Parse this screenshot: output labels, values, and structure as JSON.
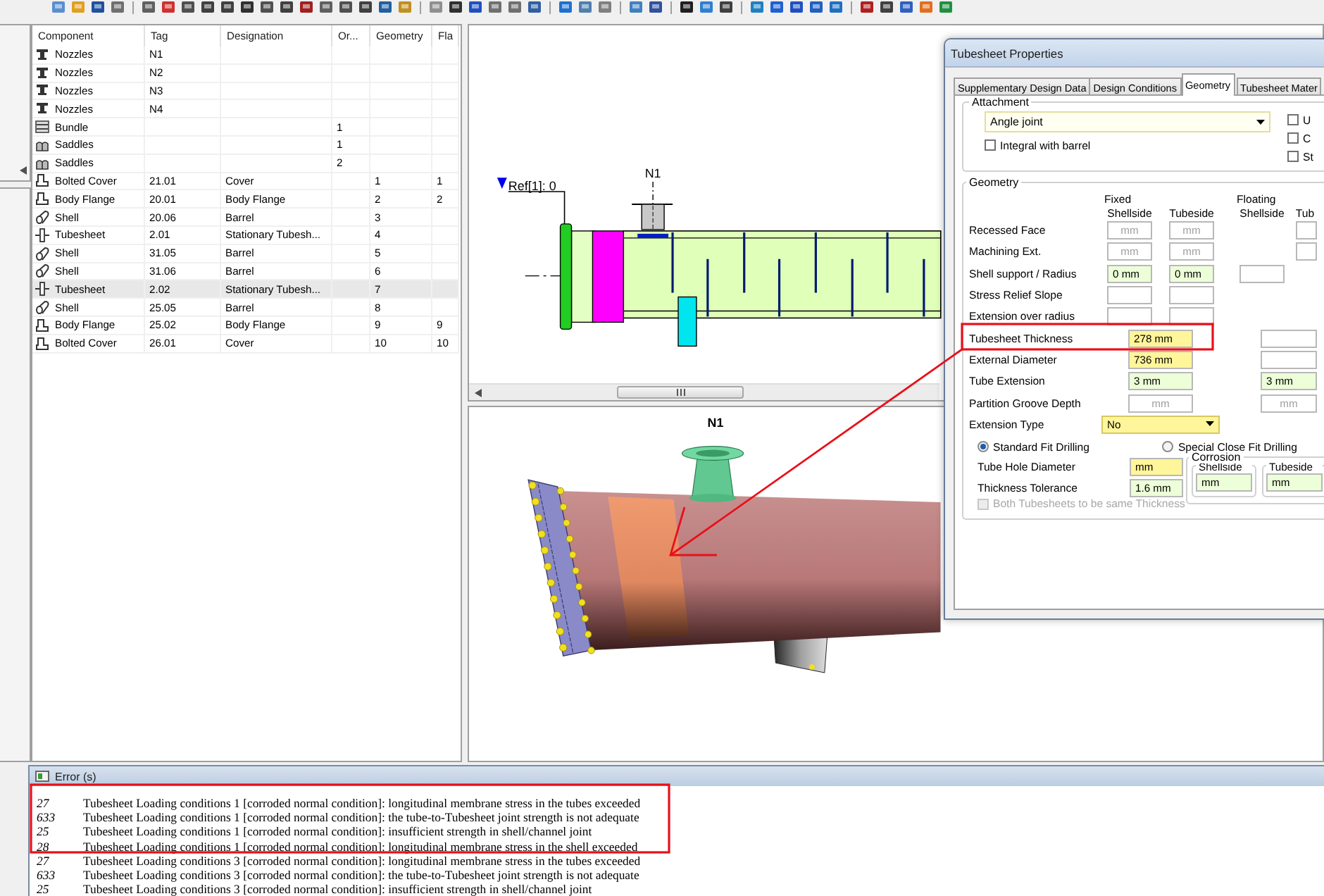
{
  "component_table": {
    "columns": [
      "Component",
      "Tag",
      "Designation",
      "Or...",
      "Geometry",
      "Fla"
    ],
    "rows": [
      {
        "kind": "nozzle",
        "component": "Nozzles",
        "tag": "N1",
        "selected": false
      },
      {
        "kind": "nozzle",
        "component": "Nozzles",
        "tag": "N2",
        "selected": false
      },
      {
        "kind": "nozzle",
        "component": "Nozzles",
        "tag": "N3",
        "selected": false
      },
      {
        "kind": "nozzle",
        "component": "Nozzles",
        "tag": "N4",
        "selected": false
      },
      {
        "kind": "bundle",
        "component": "Bundle",
        "column_4": "1",
        "selected": false
      },
      {
        "kind": "saddle",
        "component": "Saddles",
        "column_4": "1",
        "selected": false
      },
      {
        "kind": "saddle",
        "component": "Saddles",
        "column_4": "2",
        "selected": false
      },
      {
        "kind": "cover",
        "component": "Bolted Cover",
        "tag": "21.01",
        "designation": "Cover",
        "geometry": "1",
        "column_6": "1",
        "selected": false
      },
      {
        "kind": "cover",
        "component": "Body Flange",
        "tag": "20.01",
        "designation": "Body Flange",
        "geometry": "2",
        "column_6": "2",
        "selected": false
      },
      {
        "kind": "shell",
        "component": "Shell",
        "tag": "20.06",
        "designation": "Barrel",
        "geometry": "3",
        "selected": false
      },
      {
        "kind": "tubesheet",
        "component": "Tubesheet",
        "tag": "2.01",
        "designation": "Stationary Tubesh...",
        "geometry": "4",
        "selected": false
      },
      {
        "kind": "shell",
        "component": "Shell",
        "tag": "31.05",
        "designation": "Barrel",
        "geometry": "5",
        "selected": false
      },
      {
        "kind": "shell",
        "component": "Shell",
        "tag": "31.06",
        "designation": "Barrel",
        "geometry": "6",
        "selected": false
      },
      {
        "kind": "tubesheet",
        "component": "Tubesheet",
        "tag": "2.02",
        "designation": "Stationary Tubesh...",
        "geometry": "7",
        "selected": true
      },
      {
        "kind": "shell",
        "component": "Shell",
        "tag": "25.05",
        "designation": "Barrel",
        "geometry": "8",
        "selected": false
      },
      {
        "kind": "cover",
        "component": "Body Flange",
        "tag": "25.02",
        "designation": "Body Flange",
        "geometry": "9",
        "column_6": "9",
        "selected": false
      },
      {
        "kind": "cover",
        "component": "Bolted Cover",
        "tag": "26.01",
        "designation": "Cover",
        "geometry": "10",
        "column_6": "10",
        "selected": false
      }
    ]
  },
  "drawing_2d": {
    "reference": "Ref[1]: 0",
    "nozzle_label": "N1"
  },
  "view_3d": {
    "nozzle_label": "N1"
  },
  "dialog": {
    "title": "Tubesheet Properties",
    "tabs": [
      {
        "label": "Supplementary Design Data",
        "selected": false
      },
      {
        "label": "Design Conditions",
        "selected": false
      },
      {
        "label": "Geometry",
        "selected": true
      },
      {
        "label": "Tubesheet Mater",
        "selected": false
      }
    ],
    "attachment": {
      "legend": "Attachment",
      "joint": {
        "value": "Angle joint",
        "color": "#fffff2"
      },
      "integral_with_barrel": {
        "label": "Integral with barrel",
        "checked": false
      },
      "side_options": [
        {
          "label": "U",
          "checked": false
        },
        {
          "label": "C",
          "checked": false
        },
        {
          "label": "St",
          "checked": false
        }
      ]
    },
    "geometry": {
      "legend": "Geometry",
      "fixed": {
        "title": "Fixed",
        "columns": [
          "Shellside",
          "Tubeside"
        ]
      },
      "floating": {
        "title": "Floating",
        "columns": [
          "Shellside",
          "Tub"
        ]
      },
      "rows": [
        {
          "label": "Recessed Face",
          "fixed_shellside": {
            "kind": "input",
            "placeholder": "mm",
            "color": "#ffffff"
          },
          "fixed_tubeside": {
            "kind": "input",
            "placeholder": "mm",
            "color": "#ffffff"
          },
          "floating_tubeside": {
            "kind": "input",
            "color": "#ffffff"
          }
        },
        {
          "label": "Machining Ext.",
          "fixed_shellside": {
            "kind": "input",
            "placeholder": "mm",
            "color": "#ffffff"
          },
          "fixed_tubeside": {
            "kind": "input",
            "placeholder": "mm",
            "color": "#ffffff"
          },
          "floating_tubeside": {
            "kind": "input",
            "color": "#ffffff"
          }
        },
        {
          "label": "Shell support / Radius",
          "fixed_shellside": {
            "kind": "input",
            "value": "0 mm",
            "color": "#ecffd8"
          },
          "fixed_tubeside": {
            "kind": "input",
            "value": "0 mm",
            "color": "#ecffd8"
          },
          "floating_shellside": {
            "kind": "input",
            "color": "#ffffff"
          }
        },
        {
          "label": "Stress Relief Slope",
          "fixed_shellside": {
            "kind": "input",
            "color": "#ffffff"
          },
          "fixed_tubeside": {
            "kind": "input",
            "color": "#ffffff"
          }
        },
        {
          "label": "Extension over radius",
          "fixed_shellside": {
            "kind": "input",
            "color": "#ffffff"
          },
          "fixed_tubeside": {
            "kind": "input",
            "color": "#ffffff"
          }
        },
        {
          "label": "Tubesheet Thickness",
          "fixed": {
            "kind": "input",
            "value": "278 mm",
            "color": "#fff59a"
          },
          "floating": {
            "kind": "input",
            "color": "#ffffff"
          }
        },
        {
          "label": "External Diameter",
          "fixed": {
            "kind": "input",
            "value": "736 mm",
            "color": "#fff59a"
          },
          "floating": {
            "kind": "input",
            "color": "#ffffff"
          }
        },
        {
          "label": "Tube Extension",
          "fixed": {
            "kind": "input",
            "value": "3 mm",
            "color": "#ecffd8"
          },
          "floating": {
            "kind": "input",
            "value": "3 mm",
            "color": "#ecffd8"
          }
        },
        {
          "label": "Partition Groove Depth",
          "fixed": {
            "kind": "input",
            "placeholder": "mm",
            "color": "#ffffff"
          },
          "floating": {
            "kind": "input",
            "placeholder": "mm",
            "color": "#ffffff"
          }
        },
        {
          "label": "Extension Type",
          "fixed": {
            "kind": "select",
            "value": "No",
            "color": "#fff59a"
          }
        }
      ]
    },
    "drilling": {
      "options": [
        {
          "label": "Standard Fit Drilling",
          "selected": true
        },
        {
          "label": "Special Close Fit Drilling",
          "selected": false
        }
      ]
    },
    "hole_fields": [
      {
        "label": "Tube Hole Diameter",
        "value": "mm",
        "color": "#fff59a"
      },
      {
        "label": "Thickness Tolerance",
        "value": "1.6 mm",
        "color": "#ecffd8"
      }
    ],
    "corrosion": {
      "legend": "Corrosion",
      "fields": [
        {
          "label": "Shellside",
          "value": "mm",
          "color": "#ecffd8"
        },
        {
          "label": "Tubeside",
          "value": "mm",
          "color": "#ecffd8"
        }
      ]
    },
    "same_thickness": {
      "label": "Both Tubesheets to be same Thickness",
      "checked": false,
      "disabled": true
    }
  },
  "error_window": {
    "title": "Error (s)",
    "lines": [
      {
        "code": "27",
        "message": "Tubesheet Loading conditions 1 [corroded normal condition]: longitudinal membrane stress in the tubes exceeded"
      },
      {
        "code": "633",
        "message": "Tubesheet Loading conditions 1 [corroded normal condition]: the tube-to-Tubesheet joint strength is not adequate"
      },
      {
        "code": "25",
        "message": "Tubesheet Loading conditions 1 [corroded normal condition]: insufficient strength in shell/channel joint"
      },
      {
        "code": "28",
        "message": "Tubesheet Loading conditions 1 [corroded normal condition]: longitudinal membrane stress in the shell exceeded"
      },
      {
        "code": "27",
        "message": "Tubesheet Loading conditions 3 [corroded normal condition]: longitudinal membrane stress in the tubes exceeded"
      },
      {
        "code": "633",
        "message": "Tubesheet Loading conditions 3 [corroded normal condition]: the tube-to-Tubesheet joint strength is not adequate"
      },
      {
        "code": "25",
        "message": "Tubesheet Loading conditions 3 [corroded normal condition]: insufficient strength in shell/channel joint"
      }
    ]
  }
}
